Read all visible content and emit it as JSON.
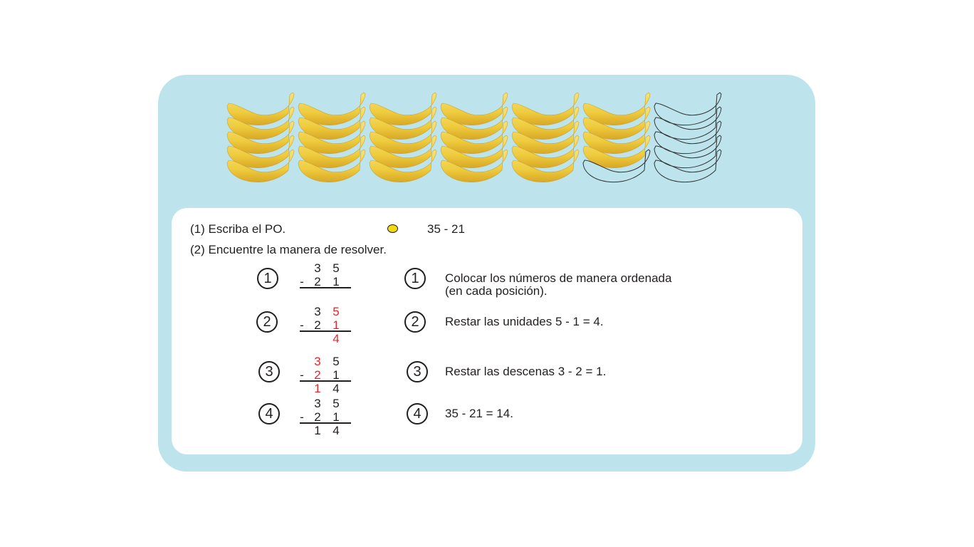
{
  "bananas": {
    "per_stack": 5,
    "filled": [
      5,
      5,
      5,
      5,
      5,
      4,
      0
    ],
    "fill_color": "#f1d14a",
    "outline_color": "#333333"
  },
  "colors": {
    "card": "#bde4ec",
    "red": "#e8262c",
    "dot": "#f5d90f"
  },
  "q1": "(1) Escriba el PO.",
  "po": "35 - 21",
  "q2": "(2) Encuentre la manera de resolver.",
  "steps": [
    {
      "n": "1",
      "top": [
        "3",
        "5"
      ],
      "bottom": [
        "2",
        "1"
      ],
      "result": [
        "",
        ""
      ],
      "minus": "-",
      "text1": "Colocar los números de manera ordenada",
      "text2": "(en cada posición)."
    },
    {
      "n": "2",
      "top": [
        "3",
        "5"
      ],
      "bottom": [
        "2",
        "1"
      ],
      "result": [
        "",
        "4"
      ],
      "minus": "-",
      "text1": "Restar las unidades 5 - 1 = 4.",
      "text2": ""
    },
    {
      "n": "3",
      "top": [
        "3",
        "5"
      ],
      "bottom": [
        "2",
        "1"
      ],
      "result": [
        "1",
        "4"
      ],
      "minus": "-",
      "text1": "Restar las descenas  3 - 2 = 1.",
      "text2": ""
    },
    {
      "n": "4",
      "top": [
        "3",
        "5"
      ],
      "bottom": [
        "2",
        "1"
      ],
      "result": [
        "1",
        "4"
      ],
      "minus": "-",
      "text1": "35 - 21 = 14.",
      "text2": ""
    }
  ]
}
